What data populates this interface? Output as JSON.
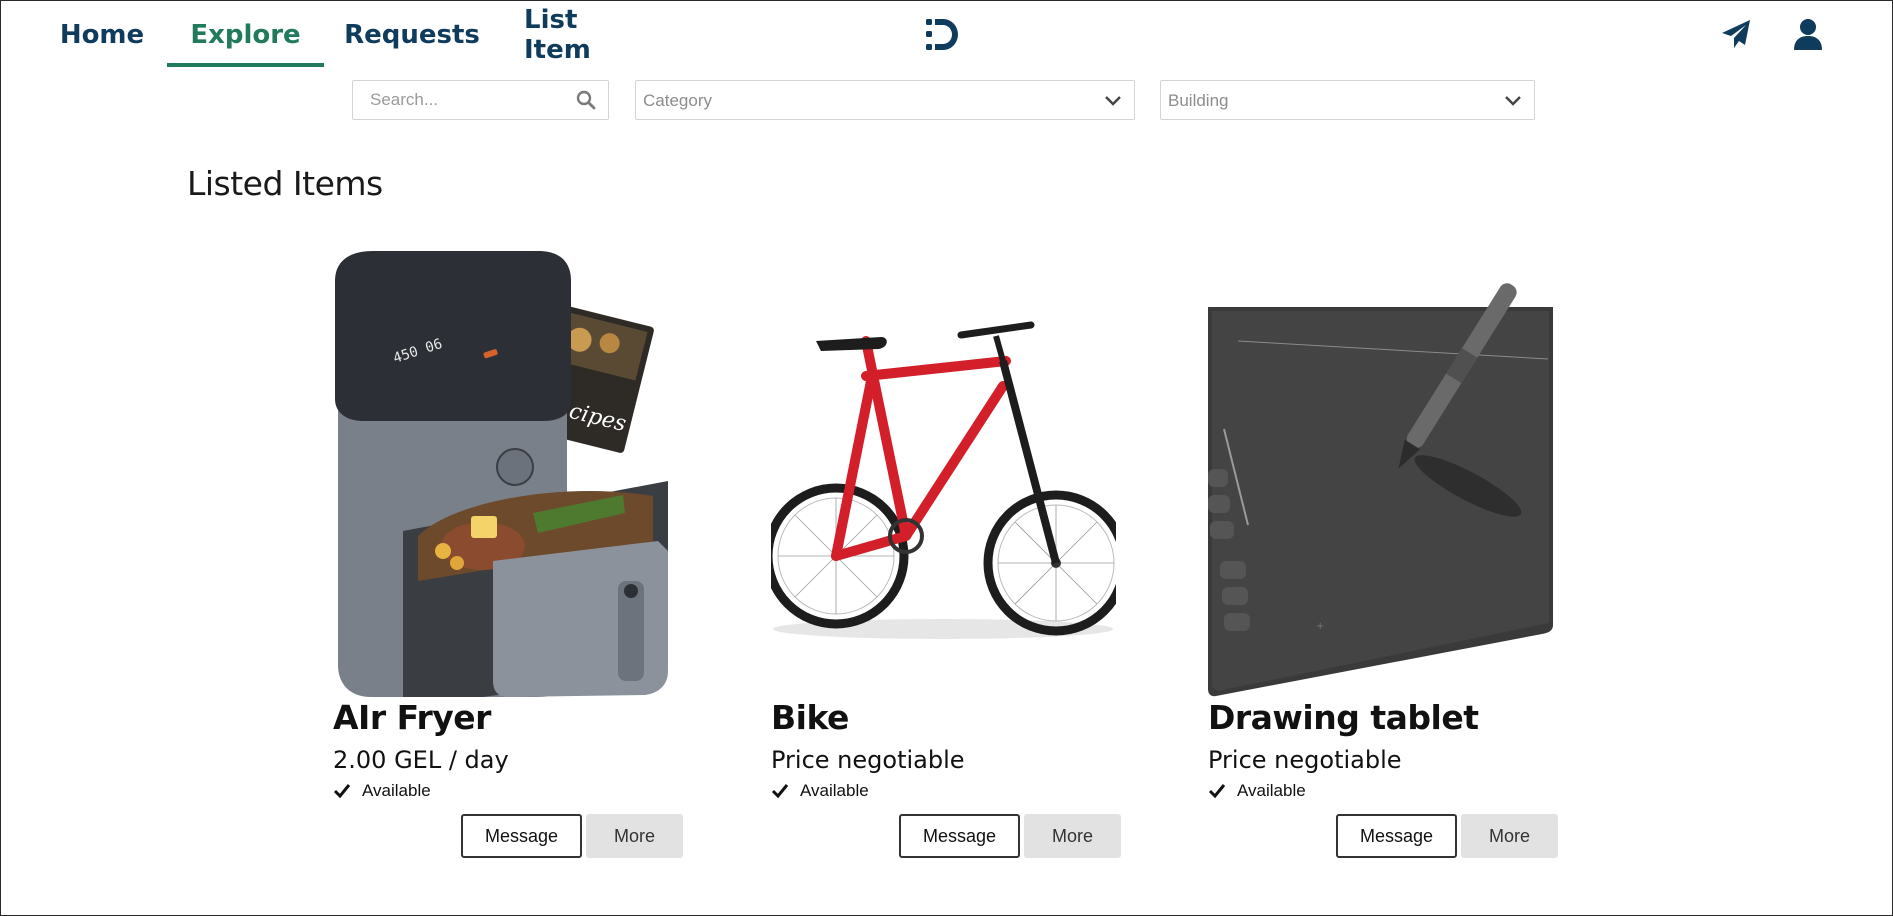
{
  "nav": {
    "tabs": [
      {
        "label": "Home",
        "active": false
      },
      {
        "label": "Explore",
        "active": true
      },
      {
        "label": "Requests",
        "active": false
      },
      {
        "label": "List Item",
        "active": false
      }
    ],
    "logo_icon": "d-logo-icon",
    "right_icons": [
      "send-icon",
      "user-icon"
    ]
  },
  "filters": {
    "search": {
      "placeholder": "Search...",
      "value": "",
      "icon": "search-icon"
    },
    "category": {
      "label": "Category",
      "icon": "chevron-down-icon"
    },
    "building": {
      "label": "Building",
      "icon": "chevron-down-icon"
    }
  },
  "page_title": "Listed Items",
  "items": [
    {
      "title": "AIr Fryer",
      "price": "2.00 GEL / day",
      "status": "Available",
      "image": "air-fryer-photo",
      "message_label": "Message",
      "more_label": "More"
    },
    {
      "title": "Bike",
      "price": "Price negotiable",
      "status": "Available",
      "image": "bike-photo",
      "message_label": "Message",
      "more_label": "More"
    },
    {
      "title": "Drawing tablet",
      "price": "Price negotiable",
      "status": "Available",
      "image": "drawing-tablet-photo",
      "message_label": "Message",
      "more_label": "More"
    }
  ],
  "colors": {
    "nav_text": "#0f3b5c",
    "active_tab": "#217a5b",
    "more_button_bg": "#e2e2e2"
  }
}
